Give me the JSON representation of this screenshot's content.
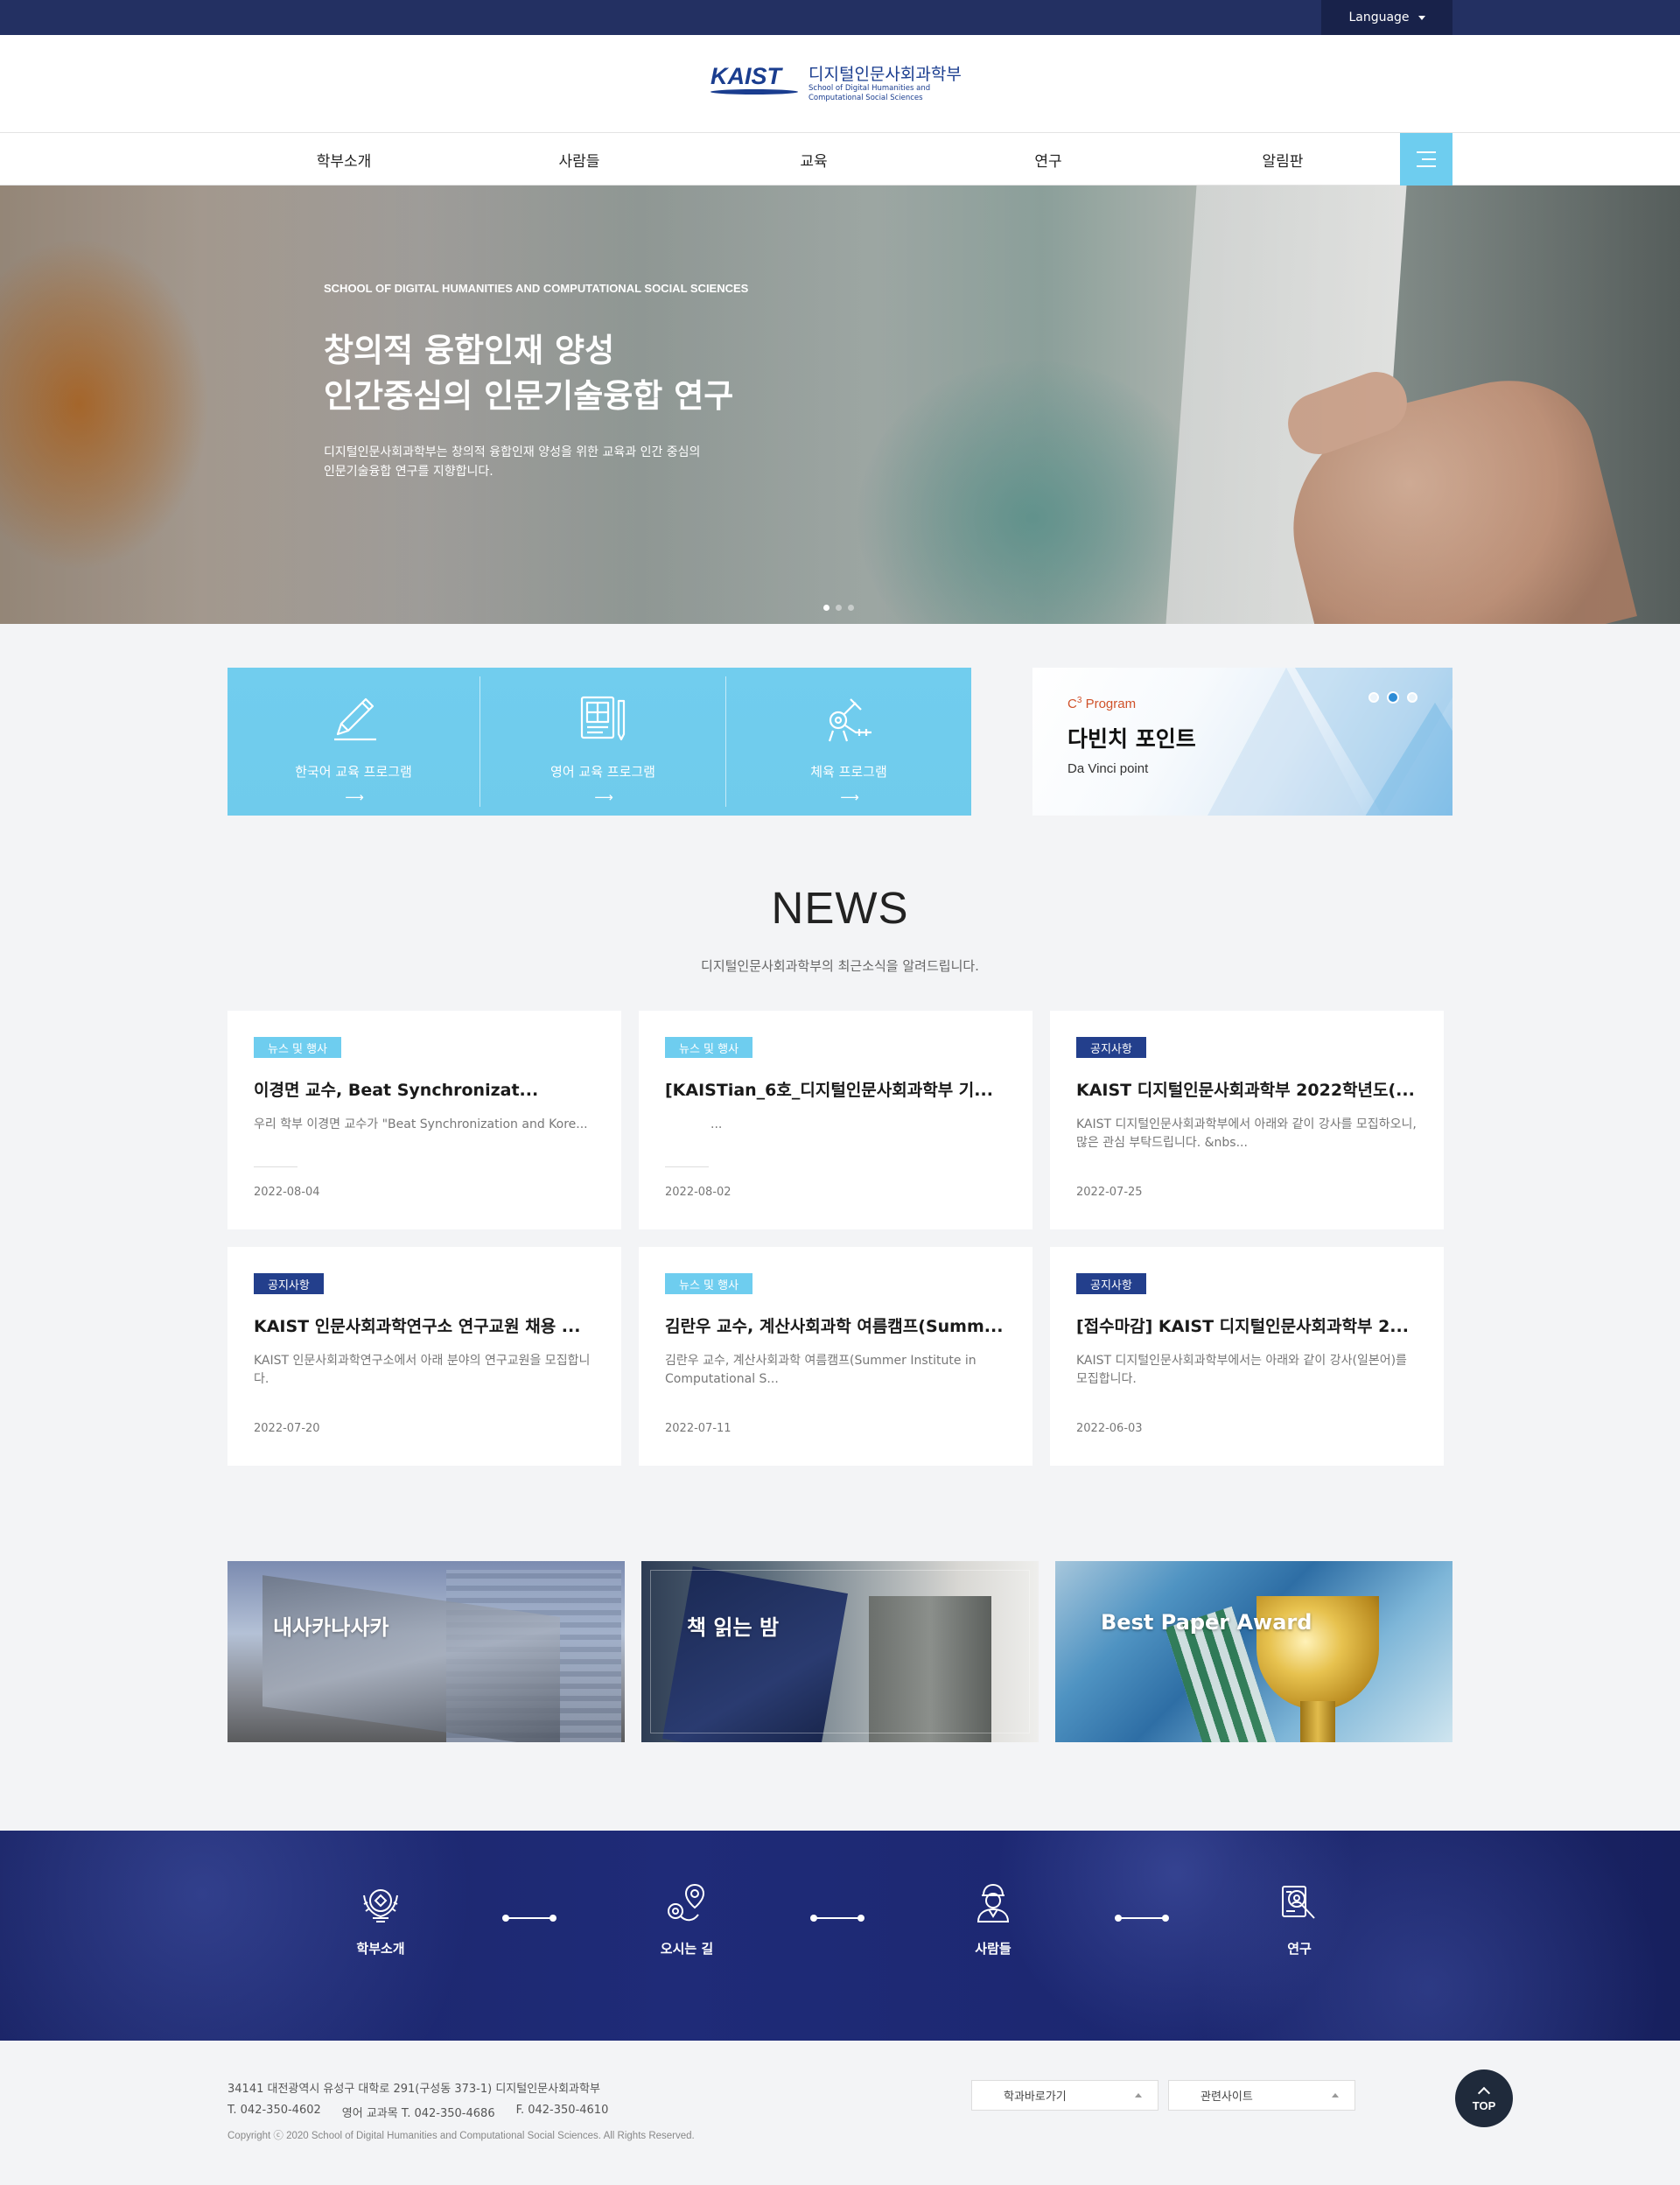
{
  "topbar": {
    "language_label": "Language"
  },
  "header": {
    "logo_word": "KAIST",
    "logo_ko": "디지털인문사회과학부",
    "logo_en_line1": "School of Digital Humanities and",
    "logo_en_line2": "Computational Social Sciences"
  },
  "nav": {
    "items": [
      "학부소개",
      "사람들",
      "교육",
      "연구",
      "알림판"
    ]
  },
  "hero": {
    "eyebrow": "SCHOOL OF DIGITAL HUMANITIES AND COMPUTATIONAL SOCIAL SCIENCES",
    "title_line1": "창의적 융합인재 양성",
    "title_line2": "인간중심의 인문기술융합 연구",
    "desc_line1": "디지털인문사회과학부는 창의적 융합인재 양성을 위한 교육과 인간 중심의",
    "desc_line2": "인문기술융합 연구를 지향합니다.",
    "slide_count": 3,
    "active_slide": 1
  },
  "quick_links": [
    {
      "label": "한국어 교육 프로그램",
      "icon": "pencil-icon",
      "arrow": "⟶"
    },
    {
      "label": "영어 교육 프로그램",
      "icon": "book-icon",
      "arrow": "⟶"
    },
    {
      "label": "체육 프로그램",
      "icon": "fitness-icon",
      "arrow": "⟶"
    }
  ],
  "c3": {
    "label_prefix": "C",
    "label_sup": "3",
    "label_suffix": " Program",
    "title": "다빈치 포인트",
    "subtitle": "Da Vinci point",
    "slide_count": 3,
    "active_slide": 2
  },
  "news": {
    "title": "NEWS",
    "subtitle": "디지털인문사회과학부의 최근소식을 알려드립니다.",
    "cards": [
      {
        "category": "뉴스 및 행사",
        "style": "sky",
        "title": "이경면 교수, Beat Synchronizat...",
        "excerpt": "우리 학부 이경면 교수가 \"Beat Synchronization and Kore...",
        "date": "2022-08-04"
      },
      {
        "category": "뉴스 및 행사",
        "style": "sky",
        "title": "[KAISTian_6호_디지털인문사회과학부 기...",
        "excerpt": "...",
        "date": "2022-08-02"
      },
      {
        "category": "공지사항",
        "style": "navy",
        "title": "KAIST 디지털인문사회과학부 2022학년도(...",
        "excerpt": "KAIST 디지털인문사회과학부에서 아래와 같이 강사를 모집하오니, 많은 관심 부탁드립니다. &nbs...",
        "date": "2022-07-25"
      },
      {
        "category": "공지사항",
        "style": "navy",
        "title": "KAIST 인문사회과학연구소 연구교원 채용 ...",
        "excerpt": "KAIST 인문사회과학연구소에서 아래 분야의 연구교원을 모집합니다.",
        "date": "2022-07-20"
      },
      {
        "category": "뉴스 및 행사",
        "style": "sky",
        "title": "김란우 교수, 계산사회과학 여름캠프(Summ...",
        "excerpt": "김란우 교수, 계산사회과학 여름캠프(Summer Institute in Computational S...",
        "date": "2022-07-11"
      },
      {
        "category": "공지사항",
        "style": "navy",
        "title": "[접수마감] KAIST 디지털인문사회과학부 2...",
        "excerpt": "KAIST 디지털인문사회과학부에서는 아래와 같이 강사(일본어)를 모집합니다.",
        "date": "2022-06-03"
      }
    ]
  },
  "banners": [
    {
      "label": "내사카나사카"
    },
    {
      "label": "책 읽는 밤"
    },
    {
      "label": "Best Paper Award"
    }
  ],
  "band": {
    "items": [
      {
        "label": "학부소개",
        "icon": "emblem-icon"
      },
      {
        "label": "오시는 길",
        "icon": "location-icon"
      },
      {
        "label": "사람들",
        "icon": "person-icon"
      },
      {
        "label": "연구",
        "icon": "research-icon"
      }
    ]
  },
  "footer": {
    "address": "34141 대전광역시 유성구 대학로 291(구성동 373-1) 디지털인문사회과학부",
    "tel": "T. 042-350-4602",
    "tel_english": "영어 교과목 T. 042-350-4686",
    "fax": "F. 042-350-4610",
    "copyright": "Copyright ⓒ 2020 School of Digital Humanities and Computational Social Sciences. All Rights Reserved.",
    "select1": "학과바로가기",
    "select2": "관련사이트",
    "top_label": "TOP"
  }
}
